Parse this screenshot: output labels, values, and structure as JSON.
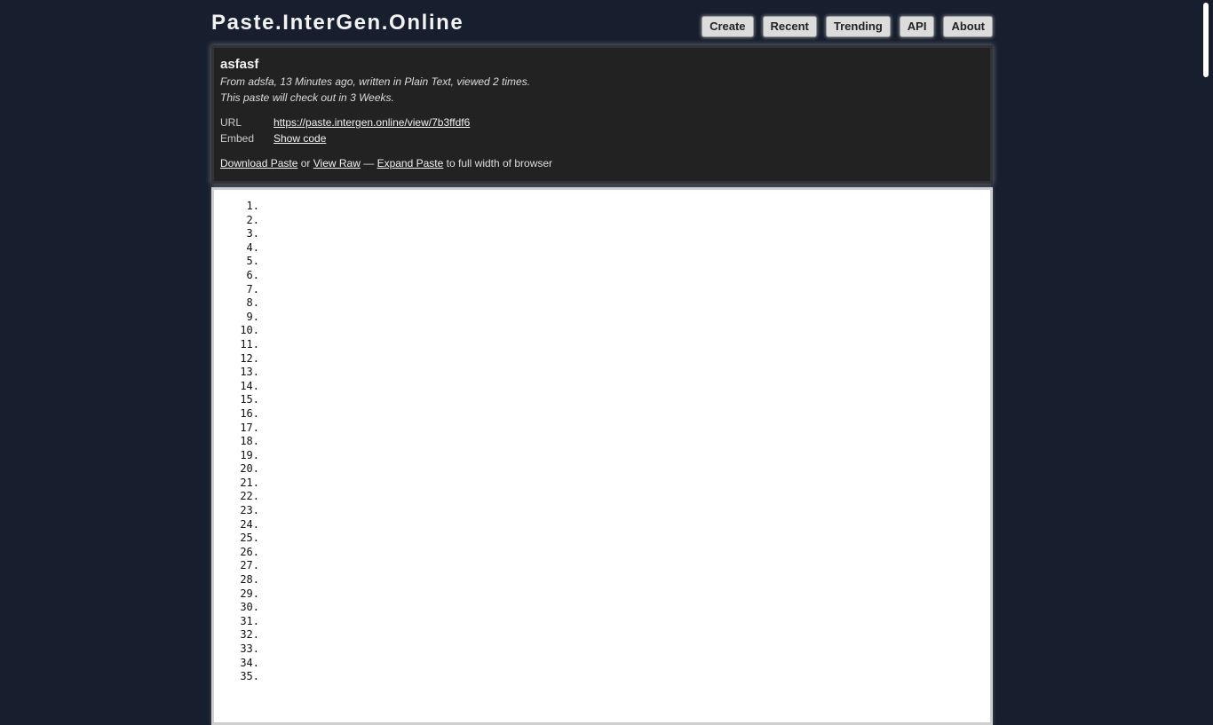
{
  "site": {
    "title": "Paste.InterGen.Online"
  },
  "nav": [
    {
      "name": "nav-create-button",
      "label": "Create"
    },
    {
      "name": "nav-recent-button",
      "label": "Recent"
    },
    {
      "name": "nav-trending-button",
      "label": "Trending"
    },
    {
      "name": "nav-api-button",
      "label": "API"
    },
    {
      "name": "nav-about-button",
      "label": "About"
    }
  ],
  "paste": {
    "title": "asfasf",
    "meta": "From adsfa, 13 Minutes ago, written in Plain Text, viewed 2 times.",
    "expiry": "This paste will check out in 3 Weeks.",
    "url_label": "URL",
    "url": "https://paste.intergen.online/view/7b3ffdf6",
    "embed_label": "Embed",
    "embed_link": "Show code",
    "download": "Download Paste",
    "or": "or",
    "view_raw": "View Raw",
    "dash": "—",
    "expand": "Expand Paste",
    "expand_suffix": "to full width of browser"
  },
  "code_lines": [
    "1.",
    "2.",
    "3.",
    "4.",
    "5.",
    "6.",
    "7.",
    "8.",
    "9.",
    "10.",
    "11.",
    "12.",
    "13.",
    "14.",
    "15.",
    "16.",
    "17.",
    "18.",
    "19.",
    "20.",
    "21.",
    "22.",
    "23.",
    "24.",
    "25.",
    "26.",
    "27.",
    "28.",
    "29.",
    "30.",
    "31.",
    "32.",
    "33.",
    "34.",
    "35."
  ]
}
